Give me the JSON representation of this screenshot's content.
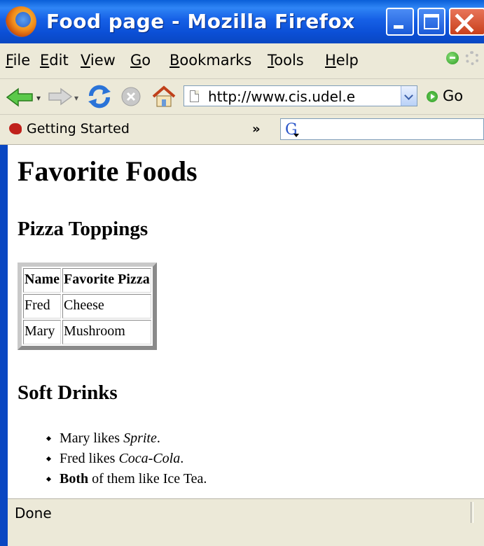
{
  "window": {
    "title": "Food page - Mozilla Firefox"
  },
  "menubar": {
    "items": [
      {
        "label": "File",
        "accel": "F",
        "rest": "ile"
      },
      {
        "label": "Edit",
        "accel": "E",
        "rest": "dit"
      },
      {
        "label": "View",
        "accel": "V",
        "rest": "iew"
      },
      {
        "label": "Go",
        "accel": "G",
        "rest": "o"
      },
      {
        "label": "Bookmarks",
        "accel": "B",
        "rest": "ookmarks"
      },
      {
        "label": "Tools",
        "accel": "T",
        "rest": "ools"
      },
      {
        "label": "Help",
        "accel": "H",
        "rest": "elp"
      }
    ]
  },
  "navbar": {
    "icons": [
      "back-arrow-icon",
      "forward-arrow-icon",
      "reload-icon",
      "stop-icon",
      "home-icon",
      "page-icon",
      "dropdown-arrow-icon",
      "go-arrow-icon"
    ],
    "url": "http://www.cis.udel.e",
    "go_label": "Go"
  },
  "bookmarks": {
    "items": [
      {
        "label": "Getting Started"
      }
    ],
    "overflow": "»",
    "search_icon": "G"
  },
  "page": {
    "h1": "Favorite Foods",
    "pizza": {
      "heading": "Pizza Toppings",
      "columns": [
        "Name",
        "Favorite Pizza"
      ],
      "rows": [
        [
          "Fred",
          "Cheese"
        ],
        [
          "Mary",
          "Mushroom"
        ]
      ]
    },
    "drinks": {
      "heading": "Soft Drinks",
      "items": [
        {
          "pre": "Mary likes ",
          "em": "Sprite",
          "post": "."
        },
        {
          "pre": "Fred likes ",
          "em": "Coca-Cola",
          "post": "."
        },
        {
          "strong": "Both",
          "post": " of them like Ice Tea."
        }
      ]
    }
  },
  "status": {
    "text": "Done"
  },
  "colors": {
    "titlebar": "#0a5fd8",
    "chrome": "#ece9d8",
    "close_button": "#c8401c",
    "url_border": "#7f9db9"
  }
}
